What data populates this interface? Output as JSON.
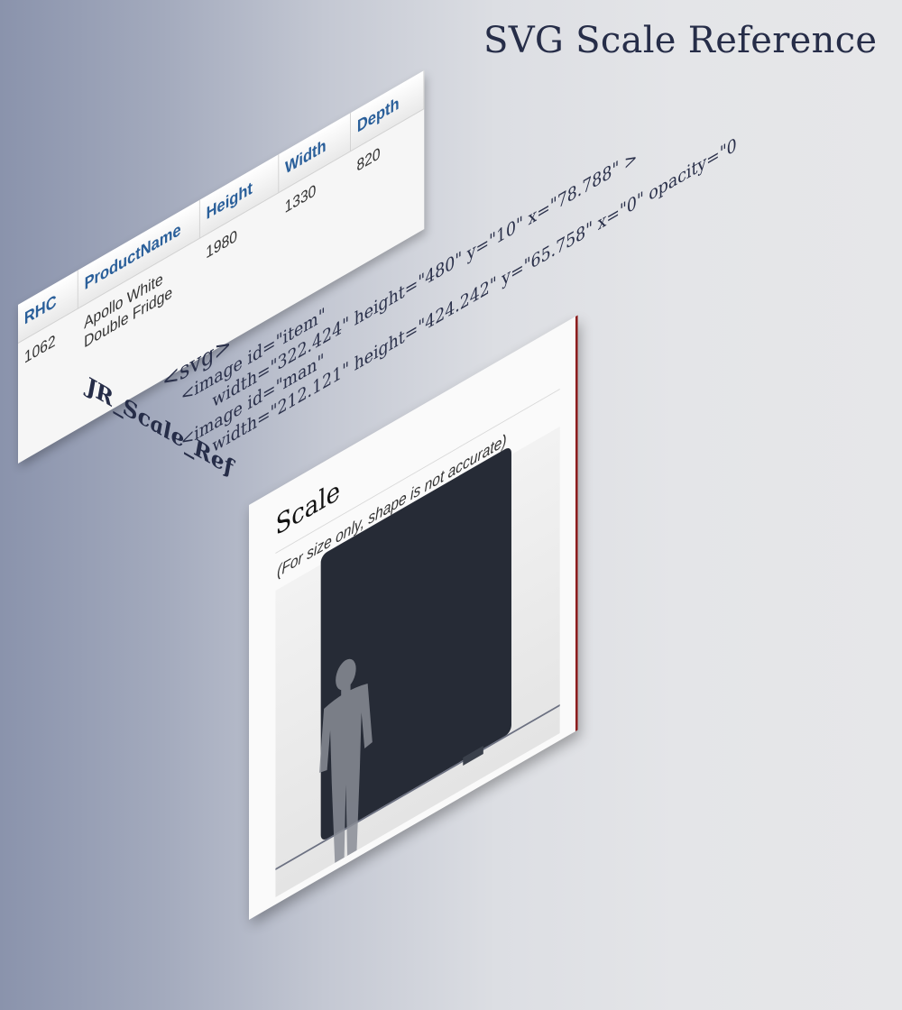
{
  "title": "SVG Scale Reference",
  "table": {
    "headers": [
      "RHC",
      "ProductName",
      "Height",
      "Width",
      "Depth"
    ],
    "row": [
      "1062",
      "Apollo White Double Fridge",
      "1980",
      "1330",
      "820"
    ]
  },
  "code": {
    "svg_tag": "<svg>",
    "line1": "<image id=\"item\"",
    "line2": "width=\"322.424\" height=\"480\" y=\"10\" x=\"78.788\" >",
    "line3": "<image id=\"man\"",
    "line4": "width=\"212.121\" height=\"424.242\" y=\"65.758\" x=\"0\" opacity=\"0"
  },
  "ref_label": "JR_Scale_Ref",
  "card": {
    "title": "Scale",
    "note": "(For size only, shape is not accurate)"
  },
  "colors": {
    "header_text": "#2a5f9a",
    "title_text": "#262d48",
    "fridge": "#262b36",
    "card_accent": "#8c1e1e"
  }
}
